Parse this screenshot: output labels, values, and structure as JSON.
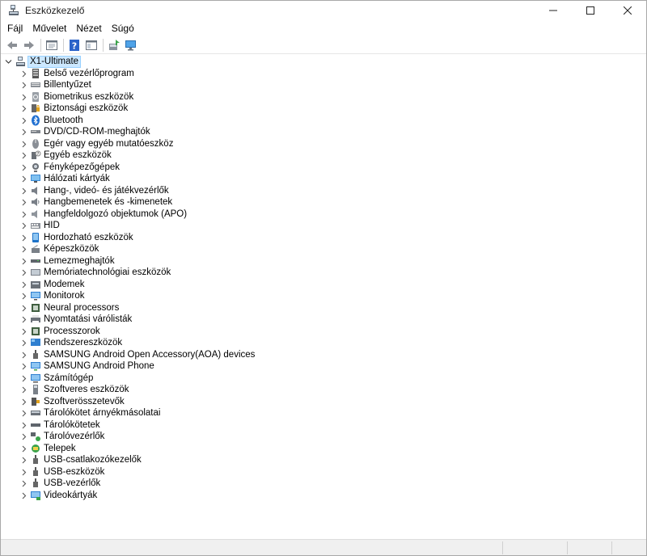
{
  "window": {
    "title": "Eszközkezelő",
    "controls": [
      "minimize",
      "maximize",
      "close"
    ]
  },
  "menu": [
    "Fájl",
    "Művelet",
    "Nézet",
    "Súgó"
  ],
  "toolbar": [
    "back-icon",
    "forward-icon",
    "properties-pane-icon",
    "help-icon",
    "console-tree-icon",
    "update-driver-icon",
    "scan-hardware-icon"
  ],
  "tree": {
    "root": "X1-Ultimate",
    "categories": [
      "Belső vezérlőprogram",
      "Billentyűzet",
      "Biometrikus eszközök",
      "Biztonsági eszközök",
      "Bluetooth",
      "DVD/CD-ROM-meghajtók",
      "Egér vagy egyéb mutatóeszköz",
      "Egyéb eszközök",
      "Fényképezőgépek",
      "Hálózati kártyák",
      "Hang-, videó- és játékvezérlők",
      "Hangbemenetek és -kimenetek",
      "Hangfeldolgozó objektumok (APO)",
      "HID",
      "Hordozható eszközök",
      "Képeszközök",
      "Lemezmeghajtók",
      "Memóriatechnológiai eszközök",
      "Modemek",
      "Monitorok",
      "Neural processors",
      "Nyomtatási várólisták",
      "Processzorok",
      "Rendszereszközök",
      "SAMSUNG Android Open Accessory(AOA) devices",
      "SAMSUNG Android Phone",
      "Számítógép",
      "Szoftveres eszközök",
      "Szoftverösszetevők",
      "Tárolókötet árnyékmásolatai",
      "Tárolókötetek",
      "Tárolóvezérlők",
      "Telepek",
      "USB-csatlakozókezelők",
      "USB-eszközök",
      "USB-vezérlők",
      "Videokártyák"
    ]
  }
}
